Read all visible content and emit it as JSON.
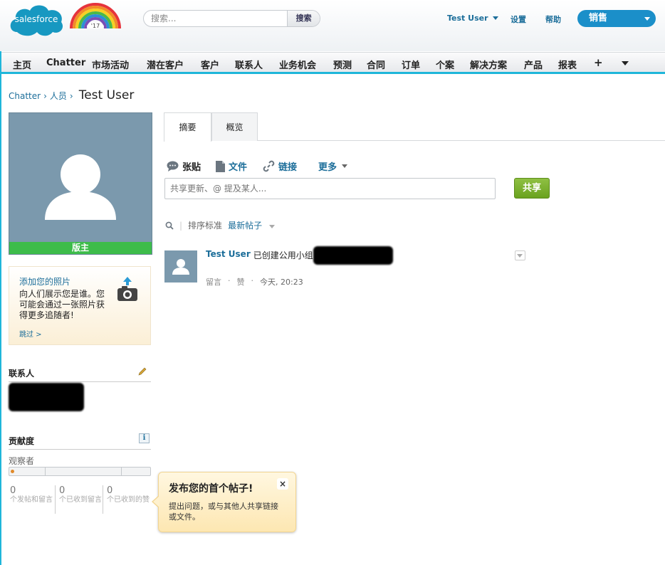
{
  "header": {
    "logo_text": "salesforce",
    "release_badge": "'17",
    "search_placeholder": "搜索...",
    "search_button": "搜索",
    "user_name": "Test User",
    "setup_link": "设置",
    "help_link": "帮助",
    "app_name": "销售"
  },
  "nav": {
    "tabs": [
      "主页",
      "Chatter",
      "市场活动",
      "潜在客户",
      "客户",
      "联系人",
      "业务机会",
      "预测",
      "合同",
      "订单",
      "个案",
      "解决方案",
      "产品",
      "报表"
    ],
    "more_tab": "+"
  },
  "breadcrumb": {
    "items": [
      "Chatter",
      "人员"
    ],
    "separator": "›",
    "title": "Test User"
  },
  "profile": {
    "role_label": "版主",
    "add_photo_title": "添加您的照片",
    "add_photo_text": "向人们展示您是谁。您可能会通过一张照片获得更多追随者!",
    "skip_link": "跳过 >",
    "contact_heading": "联系人",
    "contribution_heading": "贡献度",
    "observer_label": "观察者",
    "progress_value": 0,
    "stats": [
      {
        "value": "0",
        "label": "个发帖和留言"
      },
      {
        "value": "0",
        "label": "个已收到留言"
      },
      {
        "value": "0",
        "label": "个已收到的赞"
      }
    ]
  },
  "tabs": {
    "summary": "摘要",
    "overview": "概览"
  },
  "publisher": {
    "post": "张贴",
    "file": "文件",
    "link": "链接",
    "more": "更多",
    "input_placeholder": "共享更新、@ 提及某人...",
    "share_button": "共享"
  },
  "feed": {
    "sort_label": "排序标准",
    "sort_value": "最新帖子",
    "item": {
      "actor": "Test User",
      "action": "已创建公用小组",
      "comment": "留言",
      "like": "赞",
      "separator": "·",
      "time": "今天, 20:23"
    }
  },
  "tooltip": {
    "title": "发布您的首个帖子!",
    "body": "提出问题，或与其他人共享链接或文件。",
    "close": "×"
  },
  "colors": {
    "accent": "#1fb6da",
    "link": "#1c6e9a",
    "role_bar": "#3dbc4a",
    "share_button": "#7ab12f"
  }
}
